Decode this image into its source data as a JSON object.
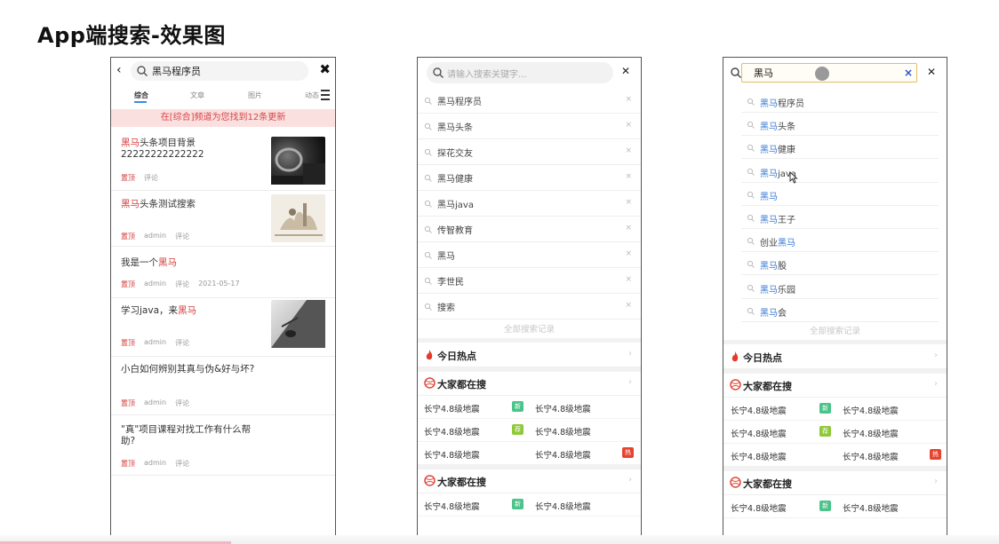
{
  "slide_title": "App端搜索-效果图",
  "phone1": {
    "query": "黑马程序员",
    "tabs": [
      "综合",
      "文章",
      "图片",
      "动态"
    ],
    "notice": "在[综合]频道为您找到12条更新",
    "articles": [
      {
        "title_hl": "黑马",
        "title_rest": "头条项目背景 22222222222222",
        "tag": "置顶",
        "author": "",
        "comment": "评论",
        "date": "",
        "thumb": "car-interior"
      },
      {
        "title_hl": "黑马",
        "title_rest": "头条测试搜索",
        "tag": "置顶",
        "author": "admin",
        "comment": "评论",
        "date": "",
        "thumb": "painting"
      },
      {
        "title_pre": "我是一个",
        "title_hl": "黑马",
        "title_rest": "",
        "tag": "置顶",
        "author": "admin",
        "comment": "评论",
        "date": "2021-05-17",
        "thumb": ""
      },
      {
        "title_pre": "学习java，来",
        "title_hl": "黑马",
        "title_rest": "",
        "tag": "置顶",
        "author": "admin",
        "comment": "评论",
        "date": "",
        "thumb": "desk"
      },
      {
        "title_pre": "小白如何辨别其真与伪&好与坏?",
        "title_hl": "",
        "title_rest": "",
        "tag": "置顶",
        "author": "admin",
        "comment": "评论",
        "date": "",
        "thumb": ""
      },
      {
        "title_pre": "\"真\"项目课程对找工作有什么帮助?",
        "title_hl": "",
        "title_rest": "",
        "tag": "置顶",
        "author": "admin",
        "comment": "评论",
        "date": "",
        "thumb": ""
      }
    ]
  },
  "phone2": {
    "placeholder": "请输入搜索关键字...",
    "history": [
      "黑马程序员",
      "黑马头条",
      "探花交友",
      "黑马健康",
      "黑马java",
      "传智教育",
      "黑马",
      "李世民",
      "搜索"
    ],
    "history_all": "全部搜索记录",
    "hot_title": "今日热点",
    "everyone_title": "大家都在搜",
    "trends": [
      {
        "left": "长宁4.8级地震",
        "badge": "新",
        "right": "长宁4.8级地震"
      },
      {
        "left": "长宁4.8级地震",
        "badge": "荐",
        "right": "长宁4.8级地震"
      },
      {
        "left": "长宁4.8级地震",
        "badge": "",
        "right": "长宁4.8级地震",
        "right_badge": "热"
      }
    ],
    "everyone_title_2": "大家都在搜",
    "trends_2": [
      {
        "left": "长宁4.8级地震",
        "badge": "新",
        "right": "长宁4.8级地震"
      }
    ]
  },
  "phone3": {
    "input_value": "黑马",
    "suggestions": [
      {
        "hl": "黑马",
        "rest": "程序员"
      },
      {
        "hl": "黑马",
        "rest": "头条"
      },
      {
        "hl": "黑马",
        "rest": "健康"
      },
      {
        "hl": "黑马",
        "rest": "java"
      },
      {
        "hl": "黑马",
        "rest": ""
      },
      {
        "hl": "黑马",
        "rest": "王子"
      },
      {
        "pre": "创业",
        "hl": "黑马",
        "rest": ""
      },
      {
        "hl": "黑马",
        "rest": "股"
      },
      {
        "hl": "黑马",
        "rest": "乐园"
      },
      {
        "hl": "黑马",
        "rest": "会"
      }
    ],
    "history_all": "全部搜索记录",
    "hot_title": "今日热点",
    "everyone_title": "大家都在搜",
    "trends": [
      {
        "left": "长宁4.8级地震",
        "badge": "新",
        "right": "长宁4.8级地震"
      },
      {
        "left": "长宁4.8级地震",
        "badge": "荐",
        "right": "长宁4.8级地震"
      },
      {
        "left": "长宁4.8级地震",
        "badge": "",
        "right": "长宁4.8级地震",
        "right_badge": "热"
      }
    ],
    "everyone_title_2": "大家都在搜",
    "trends_2": [
      {
        "left": "长宁4.8级地震",
        "badge": "新",
        "right": "长宁4.8级地震"
      }
    ]
  },
  "colors": {
    "highlight_red": "#d43c3c",
    "highlight_blue": "#3a7bd5",
    "badge_new": "#4cc38a",
    "badge_rec": "#8fc93a",
    "badge_hot": "#e6442e",
    "notice_bg": "#fbe0e0"
  },
  "icons": {
    "search": "search-icon",
    "close": "close-icon",
    "back": "back-arrow-icon",
    "menu": "menu-icon",
    "flame": "flame-icon",
    "ball": "basketball-icon"
  }
}
